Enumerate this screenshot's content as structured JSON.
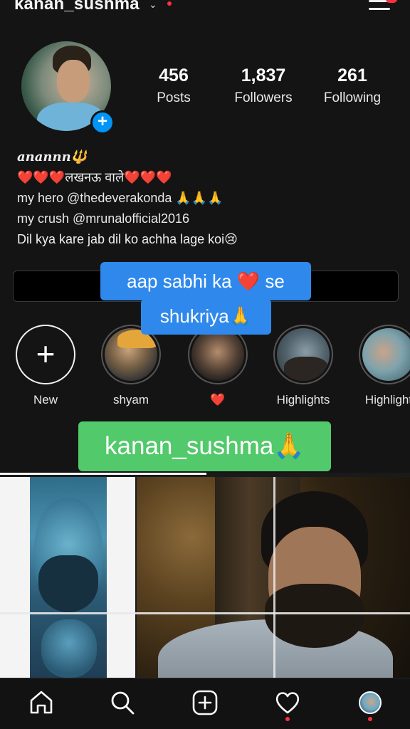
{
  "header": {
    "username": "kanan_sushma",
    "switch_icon": "chevron-down-icon",
    "menu_icon": "hamburger-menu-icon"
  },
  "profile": {
    "stats": [
      {
        "value": "456",
        "label": "Posts"
      },
      {
        "value": "1,837",
        "label": "Followers"
      },
      {
        "value": "261",
        "label": "Following"
      }
    ],
    "bio_name": "anannn🔱",
    "bio_lines": [
      "❤️❤️❤️लखनऊ वाले❤️❤️❤️",
      "my hero @thedeverakonda 🙏🙏🙏",
      "my crush @mrunalofficial2016",
      "Dil kya kare jab dil ko achha lage koi😢"
    ]
  },
  "captions": {
    "line1": "aap sabhi ka ❤️ se",
    "line2": "shukriya🙏",
    "name": "kanan_sushma🙏"
  },
  "highlights": [
    {
      "label": "New",
      "icon": "plus-icon"
    },
    {
      "label": "shyam"
    },
    {
      "label": "❤️"
    },
    {
      "label": "Highlights"
    },
    {
      "label": "Highlight"
    }
  ],
  "nav": {
    "items": [
      "home-icon",
      "search-icon",
      "create-post-icon",
      "heart-icon",
      "profile-avatar"
    ],
    "accent": "#ff3040"
  },
  "colors": {
    "background": "#141414",
    "caption_blue": "#2f89ec",
    "caption_green": "#52c96a",
    "badge_blue": "#0095f6"
  }
}
